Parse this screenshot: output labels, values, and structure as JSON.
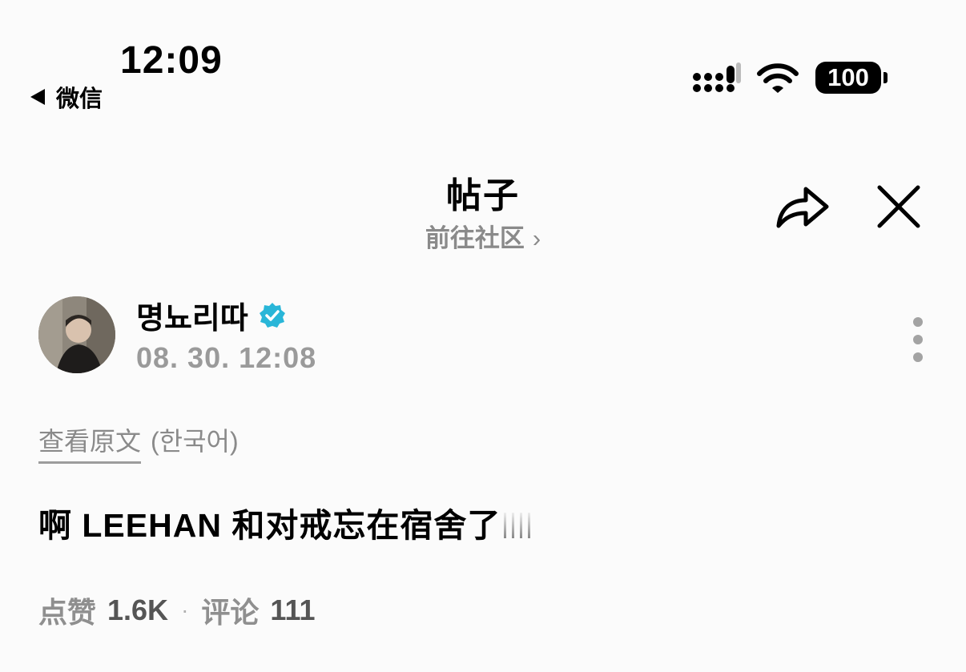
{
  "status_bar": {
    "time": "12:09",
    "back_app_label": "微信",
    "battery_level": "100"
  },
  "header": {
    "title": "帖子",
    "subtitle": "前往社区",
    "subtitle_chevron": "›"
  },
  "post": {
    "author_name": "명뇨리따",
    "verified": true,
    "timestamp": "08. 30. 12:08",
    "view_original_label": "查看原文",
    "original_language": "(한국어)",
    "body": "啊 LEEHAN 和对戒忘在宿舍了"
  },
  "stats": {
    "likes_label": "点赞",
    "likes_count": "1.6K",
    "separator": "·",
    "comments_label": "评论",
    "comments_count": "111"
  },
  "colors": {
    "background": "#fbfbfb",
    "verified_badge": "#29b6d8",
    "muted_text": "#8a8a8a"
  },
  "icons": {
    "share": "share-arrow-icon",
    "close": "close-icon",
    "more": "more-vertical-icon",
    "verified": "verified-badge-icon",
    "signal": "signal-icon",
    "wifi": "wifi-icon",
    "battery": "battery-icon"
  }
}
